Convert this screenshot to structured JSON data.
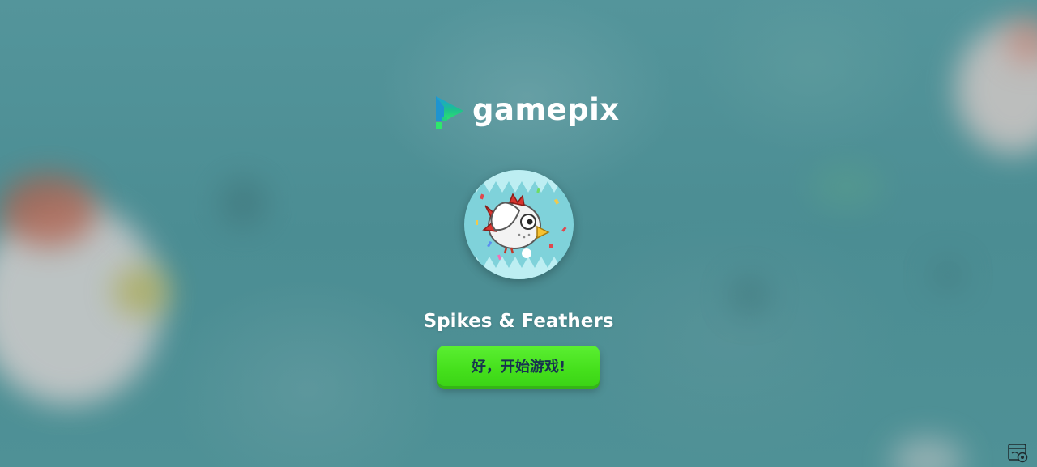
{
  "brand": {
    "name": "gamepix",
    "logo_icon": "gamepix-play-logo-icon",
    "logo_colors": [
      "#1a9de0",
      "#1ec28b",
      "#2ee86b"
    ]
  },
  "game": {
    "title": "Spikes & Feathers",
    "thumbnail_icon": "chicken-bird-icon"
  },
  "actions": {
    "play_label": "好，开始游戏!"
  },
  "corner": {
    "icon": "browser-settings-icon"
  },
  "colors": {
    "background": "#4f9096",
    "play_button": "#45e01c",
    "play_text": "#17334f",
    "thumbnail_bg": "#7fd2da"
  }
}
